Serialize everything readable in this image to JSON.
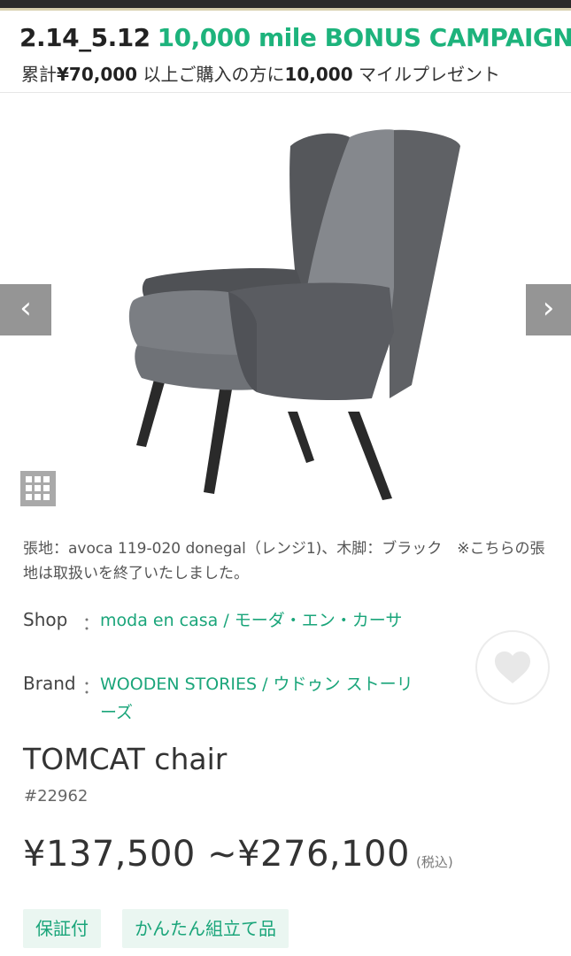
{
  "campaign": {
    "dates": "2.14_5.12",
    "title": "10,000 mile BONUS CAMPAIGN",
    "line2_pre": "累計",
    "line2_amount": "¥70,000",
    "line2_mid": "以上ご購入の方に",
    "line2_miles": "10,000",
    "line2_post": "マイルプレゼント"
  },
  "gallery": {
    "prev_icon": "chevron-left-icon",
    "next_icon": "chevron-right-icon",
    "grid_icon": "grid-icon",
    "prev_glyph": "‹",
    "next_glyph": "›"
  },
  "product": {
    "material": "張地：avoca 119-020 donegal（レンジ1)、木脚：ブラック　※こちらの張地は取扱いを終了いたしました。",
    "shop_label": "Shop",
    "shop_value": "moda en casa / モーダ・エン・カーサ",
    "brand_label": "Brand",
    "brand_value": "WOODEN STORIES / ウドゥン ストーリーズ",
    "separator": "：",
    "name": "TOMCAT chair",
    "id": "#22962",
    "price": "¥137,500 ~¥276,100",
    "tax_note": "(税込)",
    "tags": [
      "保証付",
      "かんたん組立て品"
    ]
  },
  "colors": {
    "accent": "#1db37c",
    "link": "#1aa57a",
    "tag_bg": "#eaf6f1"
  }
}
